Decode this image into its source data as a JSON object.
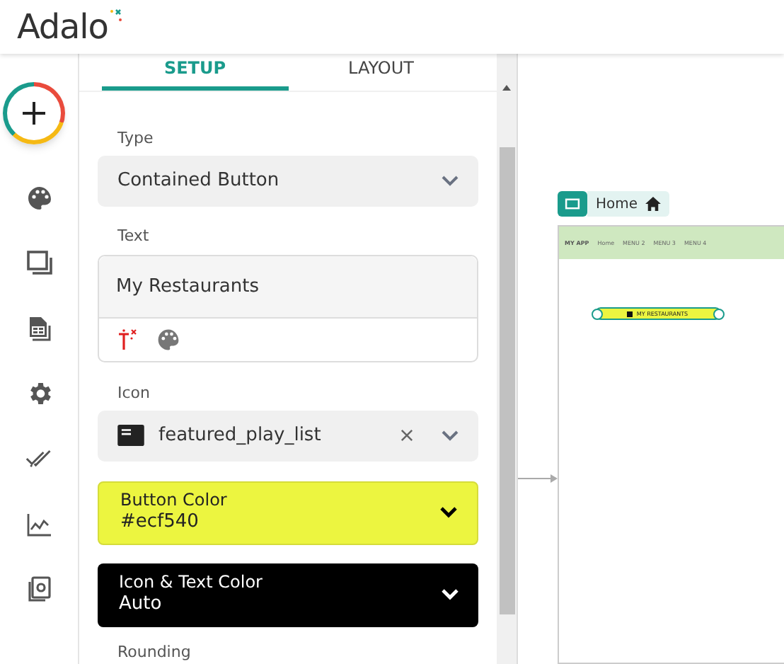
{
  "logo": "Adalo",
  "sidebar": {
    "items": [
      {
        "kind": "add"
      },
      {
        "kind": "palette"
      },
      {
        "kind": "screens"
      },
      {
        "kind": "database"
      },
      {
        "kind": "settings"
      },
      {
        "kind": "publish"
      },
      {
        "kind": "analytics"
      },
      {
        "kind": "components"
      }
    ]
  },
  "tabs": [
    {
      "label": "SETUP",
      "selected": true
    },
    {
      "label": "LAYOUT",
      "selected": false
    }
  ],
  "type_field": {
    "label": "Type",
    "value": "Contained Button"
  },
  "text_field": {
    "label": "Text",
    "value": "My Restaurants"
  },
  "icon_field": {
    "label": "Icon",
    "value": "featured_play_list"
  },
  "color_fields": [
    {
      "label": "Button Color",
      "value": "#ecf540",
      "color": "#ecf540"
    },
    {
      "label": "Icon & Text Color",
      "value": "Auto",
      "color": "#000000"
    }
  ],
  "next_label": "Rounding",
  "canvas": {
    "screen_name": "Home",
    "nav": [
      "MY APP",
      "Home",
      "MENU 2",
      "MENU 3",
      "MENU 4"
    ],
    "button_label": "MY RESTAURANTS"
  }
}
